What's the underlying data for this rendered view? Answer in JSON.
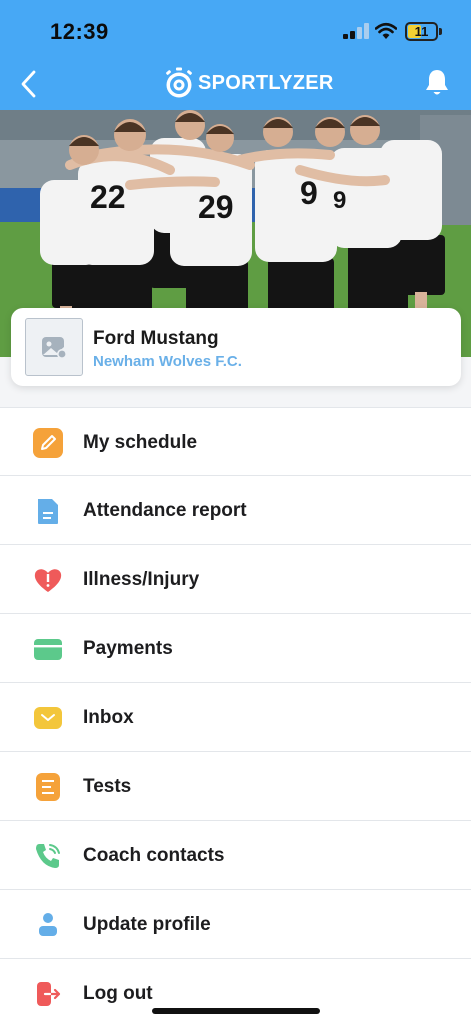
{
  "status_bar": {
    "time": "12:39",
    "battery": "11"
  },
  "header": {
    "logo_text": "SPORTLYZER"
  },
  "profile": {
    "name": "Ford Mustang",
    "team": "Newham Wolves F.C."
  },
  "menu": [
    {
      "label": "My schedule",
      "icon": "pencil-icon",
      "color": "#f5a23a"
    },
    {
      "label": "Attendance report",
      "icon": "document-icon",
      "color": "#64aee8"
    },
    {
      "label": "Illness/Injury",
      "icon": "heart-alert-icon",
      "color": "#ef5a5a"
    },
    {
      "label": "Payments",
      "icon": "card-icon",
      "color": "#5cc98b"
    },
    {
      "label": "Inbox",
      "icon": "envelope-icon",
      "color": "#f3c63b"
    },
    {
      "label": "Tests",
      "icon": "list-icon",
      "color": "#f5a23a"
    },
    {
      "label": "Coach contacts",
      "icon": "phone-icon",
      "color": "#5cc98b"
    },
    {
      "label": "Update profile",
      "icon": "user-icon",
      "color": "#64aee8"
    },
    {
      "label": "Log out",
      "icon": "logout-icon",
      "color": "#ef5a5a"
    }
  ]
}
